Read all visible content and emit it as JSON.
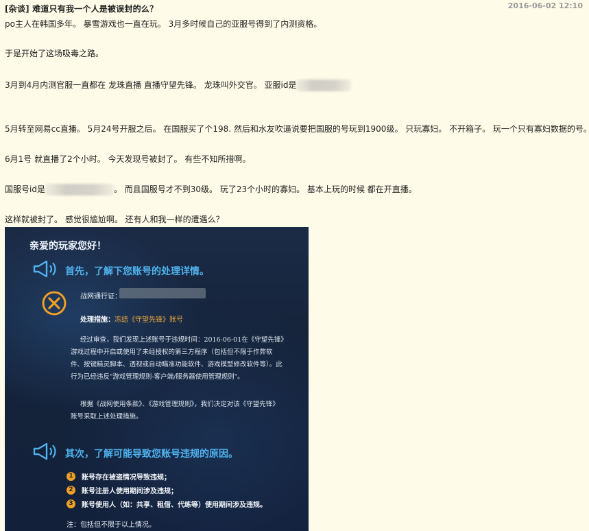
{
  "post": {
    "tag": "[杂谈]",
    "title": "难道只有我一个人是被误封的么？",
    "date": "2016-06-02 12:10"
  },
  "body": {
    "line1": "po主人在韩国多年。 暴雪游戏也一直在玩。 3月多时候自己的亚服号得到了内测资格。",
    "line2": "于是开始了这场吸毒之路。",
    "line3": "3月到4月内测官服一直都在 龙珠直播 直播守望先锋。 龙珠叫外交官。 亚服id是",
    "line4": "5月转至网易cc直播。 5月24号开服之后。 在国服买了个198. 然后和水友吹逼说要把国服的号玩到1900级。 只玩寡妇。 不开箱子。 玩一个只有寡妇数据的号。",
    "line5": "6月1号 就直播了2个小时。 今天发现号被封了。 有些不知所措啊。",
    "line6a": "国服号id是",
    "line6b": "。 而且国服号才不到30级。 玩了23个小时的寡妇。 基本上玩的时候 都在开直播。",
    "line7": "这样就被封了。 感觉很尴尬啊。 还有人和我一样的遭遇么？"
  },
  "notice": {
    "greeting": "亲爱的玩家您好！",
    "section1_title": "首先，了解下您账号的处理详情。",
    "account_label": "战网通行证：",
    "measure_label": "处理措施：",
    "measure_value": "冻结《守望先锋》账号",
    "para1": "经过审查，我们发现上述账号于违规时间：2016-06-01在《守望先锋》游戏过程中开启或使用了未经授权的第三方程序（包括但不限于作弊软件、按键精灵脚本、透视或自动瞄准功能软件、游戏模型修改软件等）。此行为已经违反\"游戏管理规则-客户端/服务器使用管理规则\"。",
    "para2": "根据《战网使用条款》、《游戏管理规则》，我们决定对该《守望先锋》账号采取上述处理措施。",
    "section2_title": "其次，了解可能导致您账号违规的原因。",
    "reasons": [
      {
        "num": "1",
        "text": "账号存在被盗情况导致违规；"
      },
      {
        "num": "2",
        "text": "账号注册人使用期间涉及违规；"
      },
      {
        "num": "3",
        "text": "账号使用人（如：共享、租借、代练等）使用期间涉及违规。"
      }
    ],
    "footnote": "注：包括但不限于以上情况。"
  },
  "colors": {
    "page_bg": "#fefbe8",
    "accent_blue": "#4fb2ee",
    "accent_orange": "#f0a024"
  }
}
